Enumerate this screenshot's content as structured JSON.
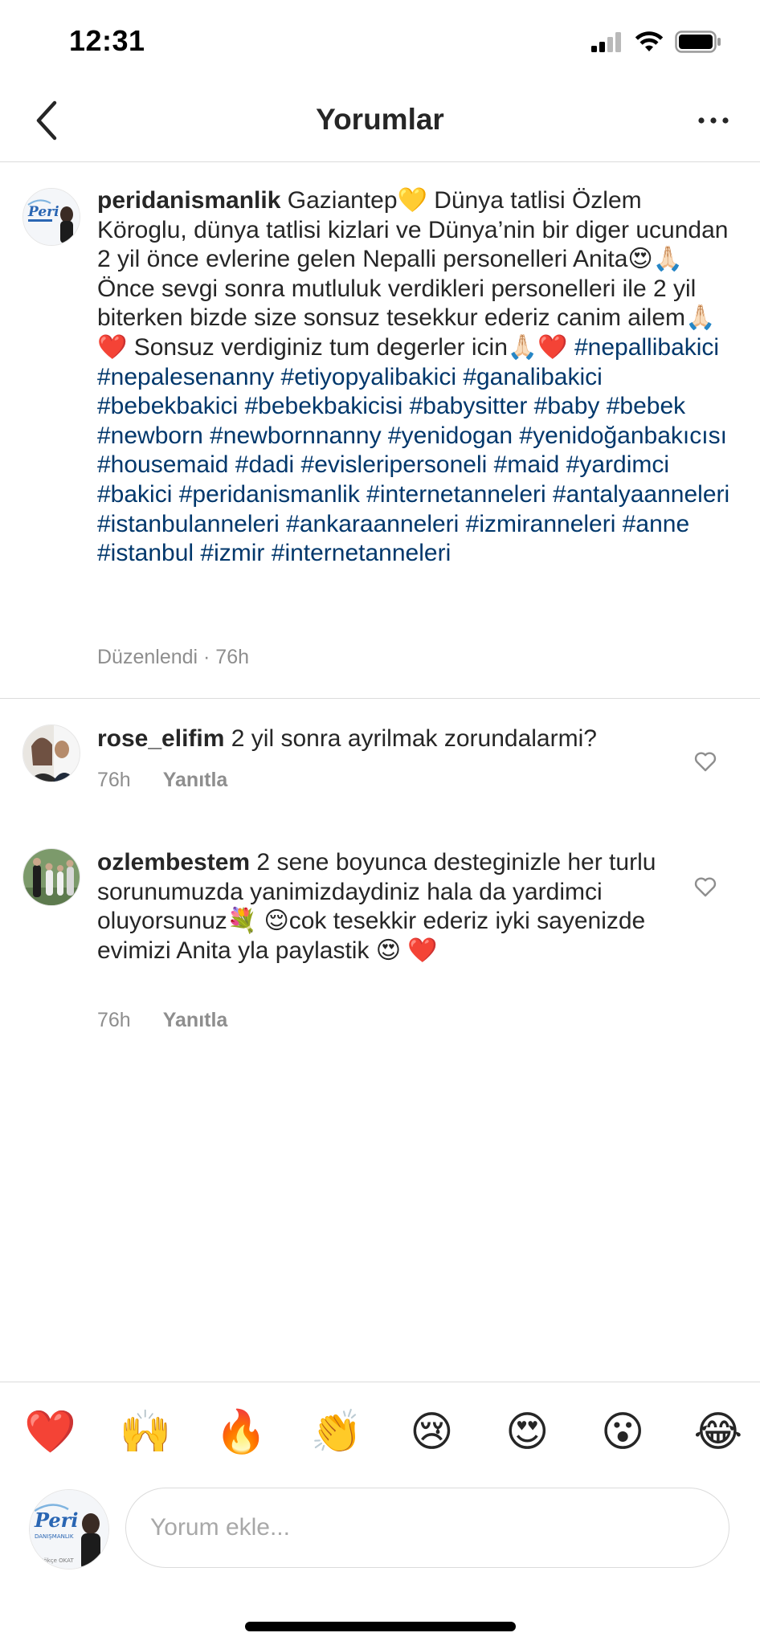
{
  "status_bar": {
    "time": "12:31"
  },
  "header": {
    "title": "Yorumlar"
  },
  "caption": {
    "username": "peridanismanlik",
    "body": "Gaziantep💛 Dünya tatlisi Özlem Köroglu, dünya tatlisi kizlari ve Dünya’nin bir diger ucundan 2 yil önce evlerine gelen Nepalli personelleri Anita😍🙏🏻 Önce sevgi sonra mutluluk verdikleri personelleri ile 2 yil biterken bizde size sonsuz tesekkur ederiz canim ailem🙏🏻❤️ Sonsuz verdiginiz tum degerler icin🙏🏻❤️",
    "hashtags": "#nepallibakici #nepalesenanny #etiyopyalibakici #ganalibakici #bebekbakici #bebekbakicisi #babysitter #baby #bebek #newborn #newbornnanny #yenidogan #yenidoğanbakıcısı #housemaid #dadi #evisleripersoneli #maid #yardimci #bakici #peridanismanlik #internetanneleri #antalyaanneleri #istanbulanneleri #ankaraanneleri #izmiranneleri #anne #istanbul #izmir #internetanneleri",
    "meta": "Düzenlendi · 76h"
  },
  "comments": [
    {
      "username": "rose_elifim",
      "text": "2 yil sonra ayrilmak zorundalarmi?",
      "time": "76h",
      "reply_label": "Yanıtla"
    },
    {
      "username": "ozlembestem",
      "text": "2 sene boyunca desteginizle her turlu sorunumuzda yanimizdaydiniz hala da yardimci oluyorsunuz💐 😌cok tesekkir ederiz iyki sayenizde  evimizi Anita yla paylastik 😍 ❤️",
      "time": "76h",
      "reply_label": "Yanıtla"
    }
  ],
  "emoji_bar": [
    "❤️",
    "🙌",
    "🔥",
    "👏",
    "😢",
    "😍",
    "😮",
    "😂"
  ],
  "composer": {
    "placeholder": "Yorum ekle...",
    "avatar_logo": "Peri",
    "avatar_logo_sub": "DANIŞMANLIK",
    "avatar_caption": "Gökçe OKAT"
  },
  "colors": {
    "hashtag": "#00376b",
    "text": "#262626",
    "secondary": "#8e8e8e",
    "divider": "#dbdbdb"
  }
}
